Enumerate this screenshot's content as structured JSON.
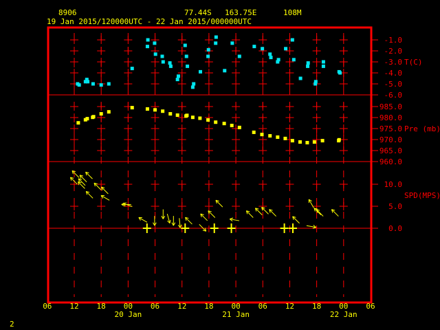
{
  "header": {
    "station_id": "8906",
    "latitude": "77.44S",
    "longitude": "163.75E",
    "elevation": "108M",
    "period": "19 Jan 2015/120000UTC - 22 Jan 2015/000000UTC"
  },
  "footer": {
    "page": "2"
  },
  "colors": {
    "frame": "#ff0000",
    "temperature": "#00e5ee",
    "pressure": "#ffff00",
    "wind": "#ffff00",
    "text": "#ffff00"
  },
  "chart_data": [
    {
      "type": "scatter",
      "title": "Temperature",
      "ylabel": "T(C)",
      "x_units": "hours since 19 Jan 2015 12UTC",
      "yticks": [
        "-1.0",
        "-2.0",
        "-3.0",
        "-4.0",
        "-5.0",
        "-6.0"
      ],
      "ylim": [
        -6,
        -1
      ],
      "x": [
        0.75,
        1.1,
        2.5,
        2.8,
        3.0,
        4.2,
        6.0,
        7.7,
        12.9,
        16.3,
        16.4,
        17.9,
        18.1,
        19.6,
        19.8,
        21.3,
        21.5,
        23.2,
        23.0,
        24.7,
        25.0,
        25.2,
        26.4,
        26.6,
        28.1,
        29.9,
        29.8,
        31.5,
        31.6,
        33.5,
        35.2,
        36.8,
        40.1,
        41.9,
        43.6,
        43.8,
        45.3,
        45.5,
        47.1,
        48.6,
        48.9,
        50.4,
        52.0,
        52.1,
        53.7,
        53.8,
        55.5,
        55.5,
        59.0,
        59.2
      ],
      "y": [
        -5.0,
        -5.1,
        -4.8,
        -4.6,
        -4.8,
        -5.0,
        -5.1,
        -5.0,
        -3.6,
        -1.6,
        -1.0,
        -1.3,
        -2.3,
        -2.5,
        -3.0,
        -3.1,
        -3.4,
        -4.3,
        -4.6,
        -1.5,
        -2.5,
        -3.4,
        -5.3,
        -5.0,
        -3.9,
        -1.9,
        -2.5,
        -1.3,
        -0.75,
        -3.8,
        -1.3,
        -2.5,
        -1.6,
        -1.8,
        -2.3,
        -2.6,
        -3.0,
        -2.8,
        -1.8,
        -1.0,
        -2.8,
        -4.5,
        -3.4,
        -3.1,
        -5.0,
        -4.8,
        -3.0,
        -3.4,
        -3.9,
        -4.0
      ]
    },
    {
      "type": "scatter",
      "title": "Pressure",
      "ylabel": "Pre (mb)",
      "x_units": "hours since 19 Jan 2015 12UTC",
      "yticks": [
        "985.0",
        "980.0",
        "975.0",
        "970.0",
        "965.0",
        "960.0"
      ],
      "ylim": [
        960,
        985
      ],
      "x": [
        0.9,
        2.5,
        2.9,
        4.1,
        4.3,
        6.0,
        7.7,
        12.9,
        16.3,
        18.0,
        19.7,
        21.4,
        23.0,
        24.9,
        25.1,
        26.4,
        28.0,
        29.8,
        31.5,
        33.4,
        35.1,
        36.8,
        40.0,
        41.8,
        43.6,
        45.3,
        47.0,
        48.6,
        50.3,
        51.9,
        53.5,
        55.3,
        58.9,
        59.0
      ],
      "y": [
        977.6,
        979.0,
        979.5,
        980.1,
        980.4,
        981.7,
        982.6,
        984.5,
        983.9,
        983.5,
        982.9,
        981.7,
        981.1,
        980.7,
        981.0,
        980.1,
        979.7,
        978.9,
        977.9,
        977.3,
        976.4,
        975.5,
        973.3,
        972.3,
        971.7,
        971.1,
        970.5,
        969.5,
        968.9,
        968.6,
        968.9,
        969.5,
        969.5,
        969.9
      ]
    },
    {
      "type": "scatter",
      "title": "Wind speed and direction",
      "ylabel": "SPD(MPS)",
      "x_units": "hours since 19 Jan 2015 12UTC",
      "yticks": [
        "10.0",
        "5.0",
        "0.0"
      ],
      "ylim": [
        -7,
        13
      ],
      "arrows": {
        "x": [
          0.3,
          -0.1,
          2.0,
          3.3,
          1.6,
          1.7,
          3.4,
          5.2,
          6.8,
          6.9,
          11.9,
          11.6,
          15.3,
          17.9,
          19.8,
          21.0,
          22.1,
          23.5,
          25.5,
          28.6,
          28.9,
          30.6,
          32.3,
          35.7,
          39.1,
          41.1,
          42.5,
          44.2,
          49.4,
          52.8,
          52.8,
          54.2,
          54.7,
          58.1
        ],
        "speed": [
          12.3,
          10.8,
          11.3,
          12.0,
          9.8,
          10.5,
          7.6,
          9.5,
          8.6,
          6.9,
          5.3,
          5.4,
          1.9,
          1.7,
          3.2,
          2.2,
          1.7,
          1.2,
          1.7,
          0.1,
          2.5,
          3.2,
          5.6,
          1.9,
          3.2,
          3.8,
          4.0,
          3.5,
          1.9,
          0.4,
          5.6,
          3.8,
          3.5,
          3.5
        ],
        "pointing_deg": [
          315,
          315,
          315,
          315,
          315,
          315,
          315,
          315,
          315,
          300,
          290,
          270,
          300,
          180,
          180,
          165,
          180,
          175,
          315,
          135,
          315,
          315,
          315,
          280,
          315,
          315,
          315,
          315,
          315,
          100,
          330,
          315,
          315,
          315
        ]
      },
      "calm_hours": [
        16.2,
        24.7,
        31.2,
        35.0,
        46.8,
        48.7
      ]
    }
  ],
  "xaxis": {
    "tick_labels": [
      "06",
      "12",
      "18",
      "00",
      "06",
      "12",
      "18",
      "00",
      "06",
      "12",
      "18",
      "00",
      "06"
    ],
    "day_labels": [
      "20 Jan",
      "21 Jan",
      "22 Jan"
    ]
  }
}
